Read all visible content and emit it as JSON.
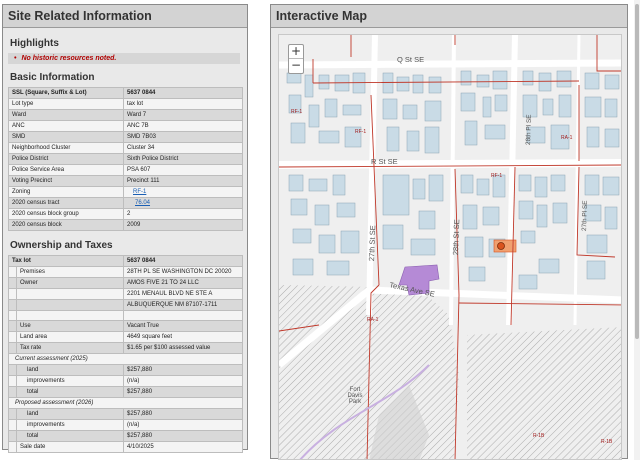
{
  "left_panel": {
    "title": "Site Related Information",
    "highlights": {
      "title": "Highlights",
      "items": [
        "No historic resources noted."
      ]
    },
    "basic": {
      "title": "Basic Information",
      "rows": [
        {
          "key": "SSL (Square, Suffix & Lot)",
          "value": "5637 0844"
        },
        {
          "key": "Lot type",
          "value": "tax lot"
        },
        {
          "key": "Ward",
          "value": "Ward 7"
        },
        {
          "key": "ANC",
          "value": "ANC 7B"
        },
        {
          "key": "SMD",
          "value": "SMD 7B03"
        },
        {
          "key": "Neighborhood Cluster",
          "value": "Cluster 34"
        },
        {
          "key": "Police District",
          "value": "Sixth Police District"
        },
        {
          "key": "Police Service Area",
          "value": "PSA 607"
        },
        {
          "key": "Voting Precinct",
          "value": "Precinct 111"
        },
        {
          "key": "Zoning",
          "value": "RF-1"
        },
        {
          "key": "2020 census tract",
          "value": "76.04"
        },
        {
          "key": "2020 census block group",
          "value": "2"
        },
        {
          "key": "2020 census block",
          "value": "2009"
        }
      ]
    },
    "ownership": {
      "title": "Ownership and Taxes",
      "tax_lot_label": "Tax lot",
      "tax_lot_value": "5637 0844",
      "rows": [
        {
          "key": "Premises",
          "value": "28TH PL SE WASHINGTON DC 20020"
        },
        {
          "key": "Owner",
          "value": "AMOS FIVE 21 TO 24 LLC"
        },
        {
          "key": "",
          "value": "2201 MENAUL BLVD NE STE A"
        },
        {
          "key": "",
          "value": "ALBUQUERQUE NM 87107-1711"
        },
        {
          "key": "",
          "value": ""
        },
        {
          "key": "Use",
          "value": "Vacant True"
        },
        {
          "key": "Land area",
          "value": "4649 square feet"
        },
        {
          "key": "Tax rate",
          "value": "$1.65 per $100 assessed value"
        }
      ],
      "current_label": "Current assessment (2025)",
      "current": [
        {
          "key": "land",
          "value": "$257,880"
        },
        {
          "key": "improvements",
          "value": "(n/a)"
        },
        {
          "key": "total",
          "value": "$257,880"
        }
      ],
      "proposed_label": "Proposed assessment (2026)",
      "proposed": [
        {
          "key": "land",
          "value": "$257,880"
        },
        {
          "key": "improvements",
          "value": "(n/a)"
        },
        {
          "key": "total",
          "value": "$257,880"
        }
      ],
      "sale_date_label": "Sale date",
      "sale_date_value": "4/10/2025"
    }
  },
  "map_panel": {
    "title": "Interactive Map",
    "zoom_in": "+",
    "zoom_out": "−",
    "streets": {
      "q_st": "Q St SE",
      "r_st": "R St SE",
      "st_27": "27th St SE",
      "st_28": "28th St SE",
      "texas_ave": "Texas Ave SE",
      "pl_28": "28th Pl SE",
      "pl_27": "27th Pl SE"
    },
    "park_label": "Fort\nDavis\nPark",
    "zones": {
      "rf1_a": "RF-1",
      "rf1_b": "RF-1",
      "ra1_a": "RA-1",
      "ra1_b": "RA-1",
      "rf1_c": "RF-1",
      "r1b": "R-1B",
      "r1b_b": "R-1B"
    },
    "colors": {
      "zoning_line": "#c0392b",
      "building": "#c9dbe6",
      "selected_parcel": "#f0a070",
      "selected_marker": "#d9531e",
      "institutional": "#b58ad6",
      "park_hatch": "#9a9a9a"
    }
  }
}
